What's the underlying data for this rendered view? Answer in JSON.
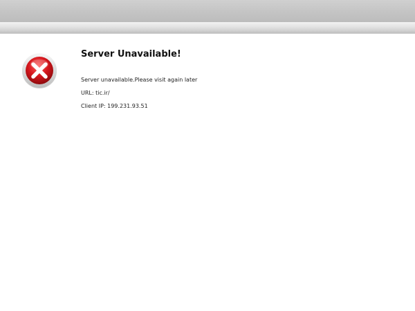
{
  "page": {
    "title": "Server Unavailable!",
    "message": "Server unavailable.Please visit again later",
    "url_line": "URL: tic.ir/",
    "client_ip_line": "Client IP: 199.231.93.51"
  },
  "icons": {
    "status": "error-x-icon"
  },
  "colors": {
    "icon_red": "#d4161c",
    "icon_ring": "#e5e5e5",
    "banner": "#c8c8c8"
  }
}
